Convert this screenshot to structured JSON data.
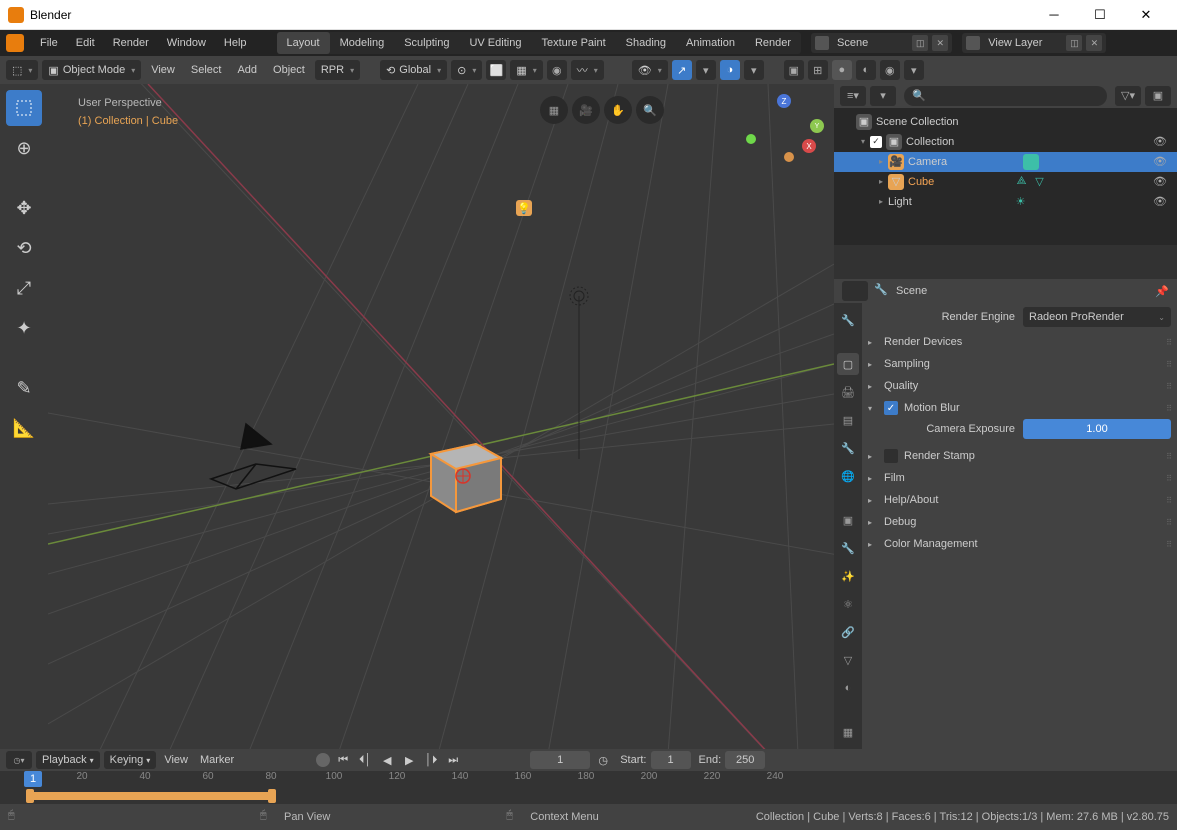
{
  "window": {
    "title": "Blender"
  },
  "menubar": [
    "File",
    "Edit",
    "Render",
    "Window",
    "Help"
  ],
  "workspaces": [
    "Layout",
    "Modeling",
    "Sculpting",
    "UV Editing",
    "Texture Paint",
    "Shading",
    "Animation",
    "Render"
  ],
  "active_workspace": "Layout",
  "scene": {
    "name": "Scene"
  },
  "viewlayer": {
    "name": "View Layer"
  },
  "header": {
    "mode": "Object Mode",
    "menus": [
      "View",
      "Select",
      "Add",
      "Object",
      "RPR"
    ],
    "orientation": "Global"
  },
  "viewport": {
    "info1": "User Perspective",
    "info2": "(1) Collection | Cube"
  },
  "outliner": {
    "root": "Scene Collection",
    "collection": "Collection",
    "items": [
      {
        "name": "Camera",
        "selected": true,
        "teal": true
      },
      {
        "name": "Cube",
        "orange": true,
        "teal2": true
      },
      {
        "name": "Light",
        "teal2g": true
      }
    ]
  },
  "properties": {
    "breadcrumb": "Scene",
    "engine_label": "Render Engine",
    "engine": "Radeon ProRender",
    "sections": {
      "render_devices": "Render Devices",
      "sampling": "Sampling",
      "quality": "Quality",
      "motion_blur": "Motion Blur",
      "render_stamp": "Render Stamp",
      "film": "Film",
      "help": "Help/About",
      "debug": "Debug",
      "color": "Color Management"
    },
    "camera_exposure_label": "Camera Exposure",
    "camera_exposure": "1.00"
  },
  "timeline": {
    "menus": {
      "playback": "Playback",
      "keying": "Keying",
      "view": "View",
      "marker": "Marker"
    },
    "current": "1",
    "start_label": "Start:",
    "start": "1",
    "end_label": "End:",
    "end": "250",
    "ticks": [
      "20",
      "40",
      "60",
      "80",
      "100",
      "120",
      "140",
      "160",
      "180",
      "200",
      "220",
      "240"
    ]
  },
  "status": {
    "pan": "Pan View",
    "context": "Context Menu",
    "info": "Collection | Cube | Verts:8 | Faces:6 | Tris:12 | Objects:1/3 | Mem: 27.6 MB | v2.80.75"
  }
}
